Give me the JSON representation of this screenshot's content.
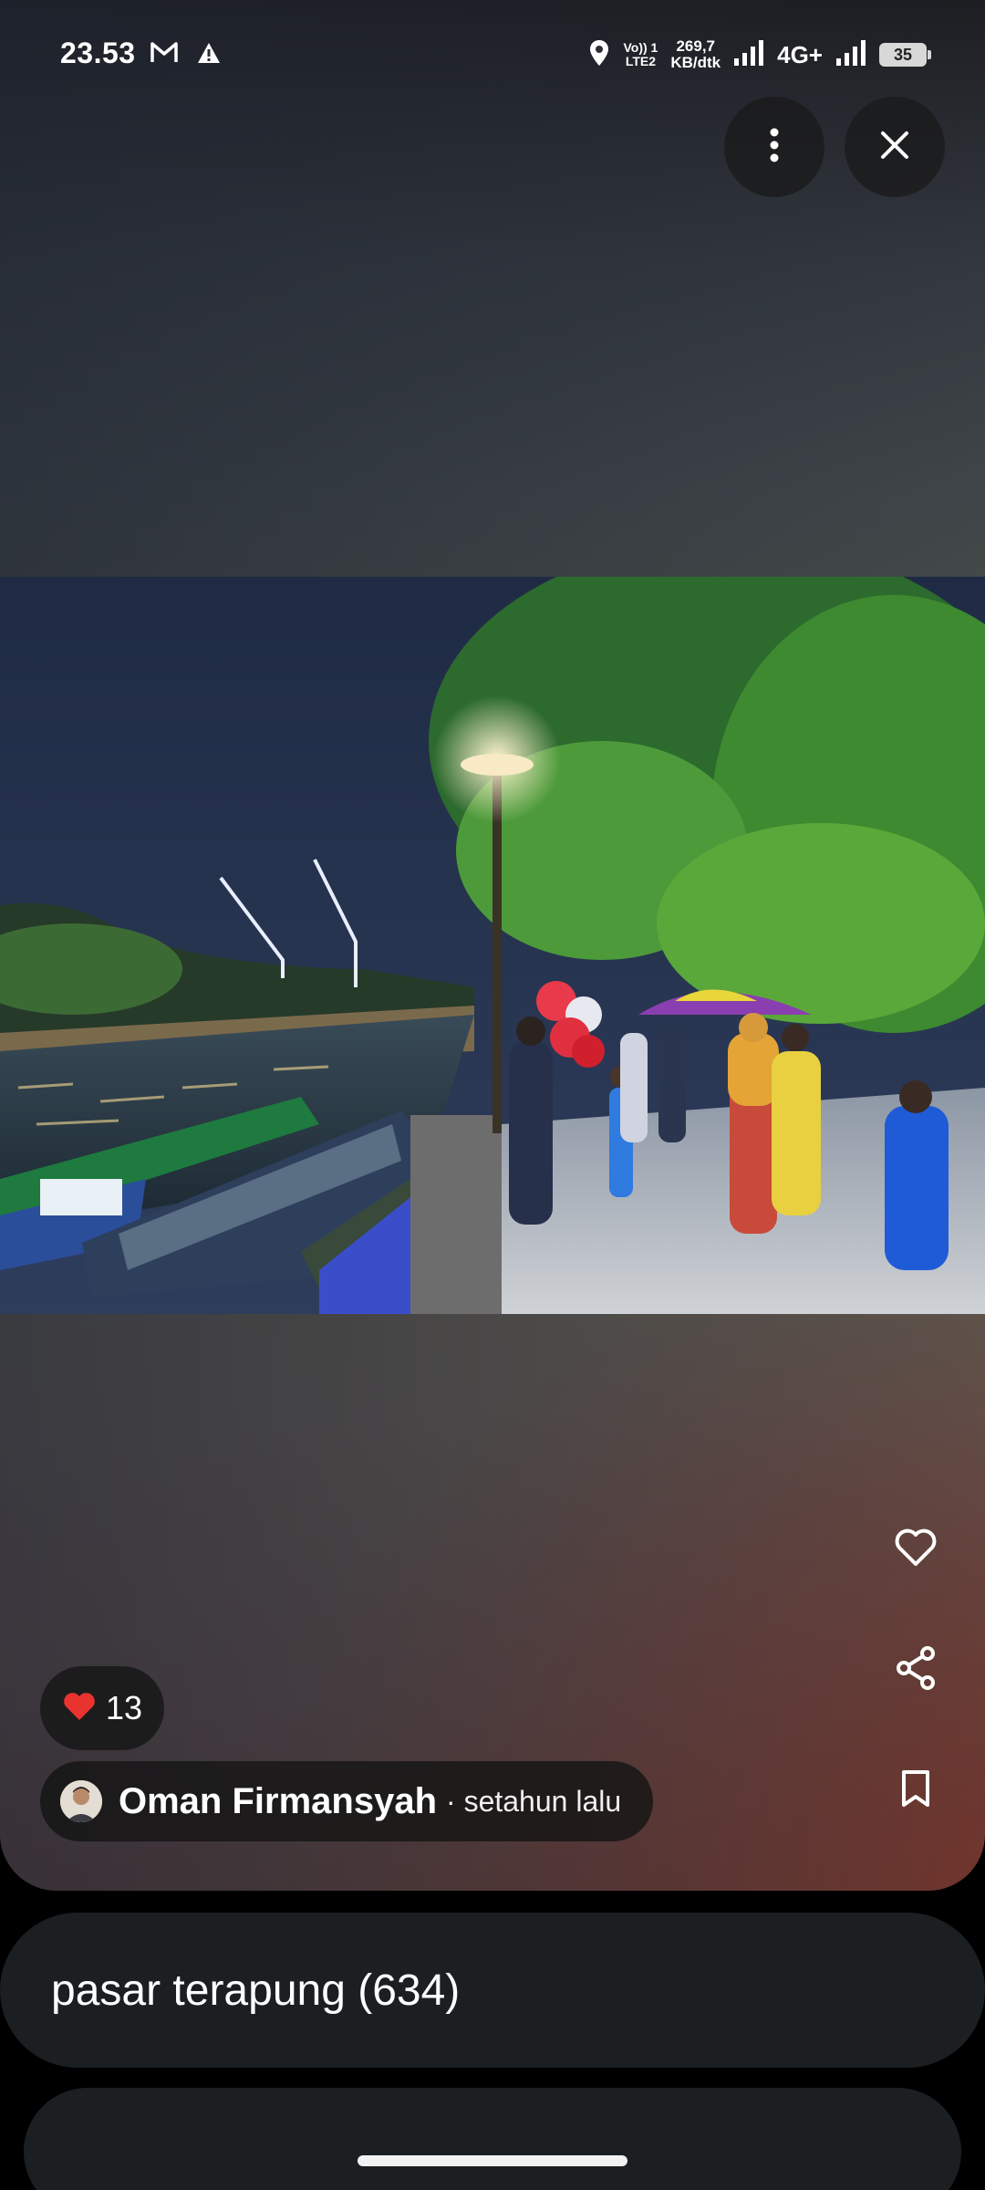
{
  "status_bar": {
    "time": "23.53",
    "volte_line1": "Vo)) 1",
    "volte_line2": "LTE2",
    "speed_value": "269,7",
    "speed_unit": "KB/dtk",
    "network": "4G+",
    "battery": "35",
    "icons": [
      "gmail-icon",
      "warning-icon",
      "location-icon",
      "signal-icon",
      "signal-icon"
    ]
  },
  "toolbar": {
    "more_icon": "more-vertical-icon",
    "close_icon": "close-icon"
  },
  "actions": {
    "favorite_icon": "heart-outline-icon",
    "share_icon": "share-icon",
    "save_icon": "bookmark-icon"
  },
  "likes": {
    "emoji": "❤️",
    "count": "13"
  },
  "author": {
    "name": "Oman Firmansyah",
    "time": "· setahun lalu"
  },
  "album": {
    "title": "pasar terapung (634)"
  },
  "colors": {
    "pill_bg": "#141414",
    "album_bar_bg": "#1c1f21",
    "accent_red": "#e8332f"
  }
}
